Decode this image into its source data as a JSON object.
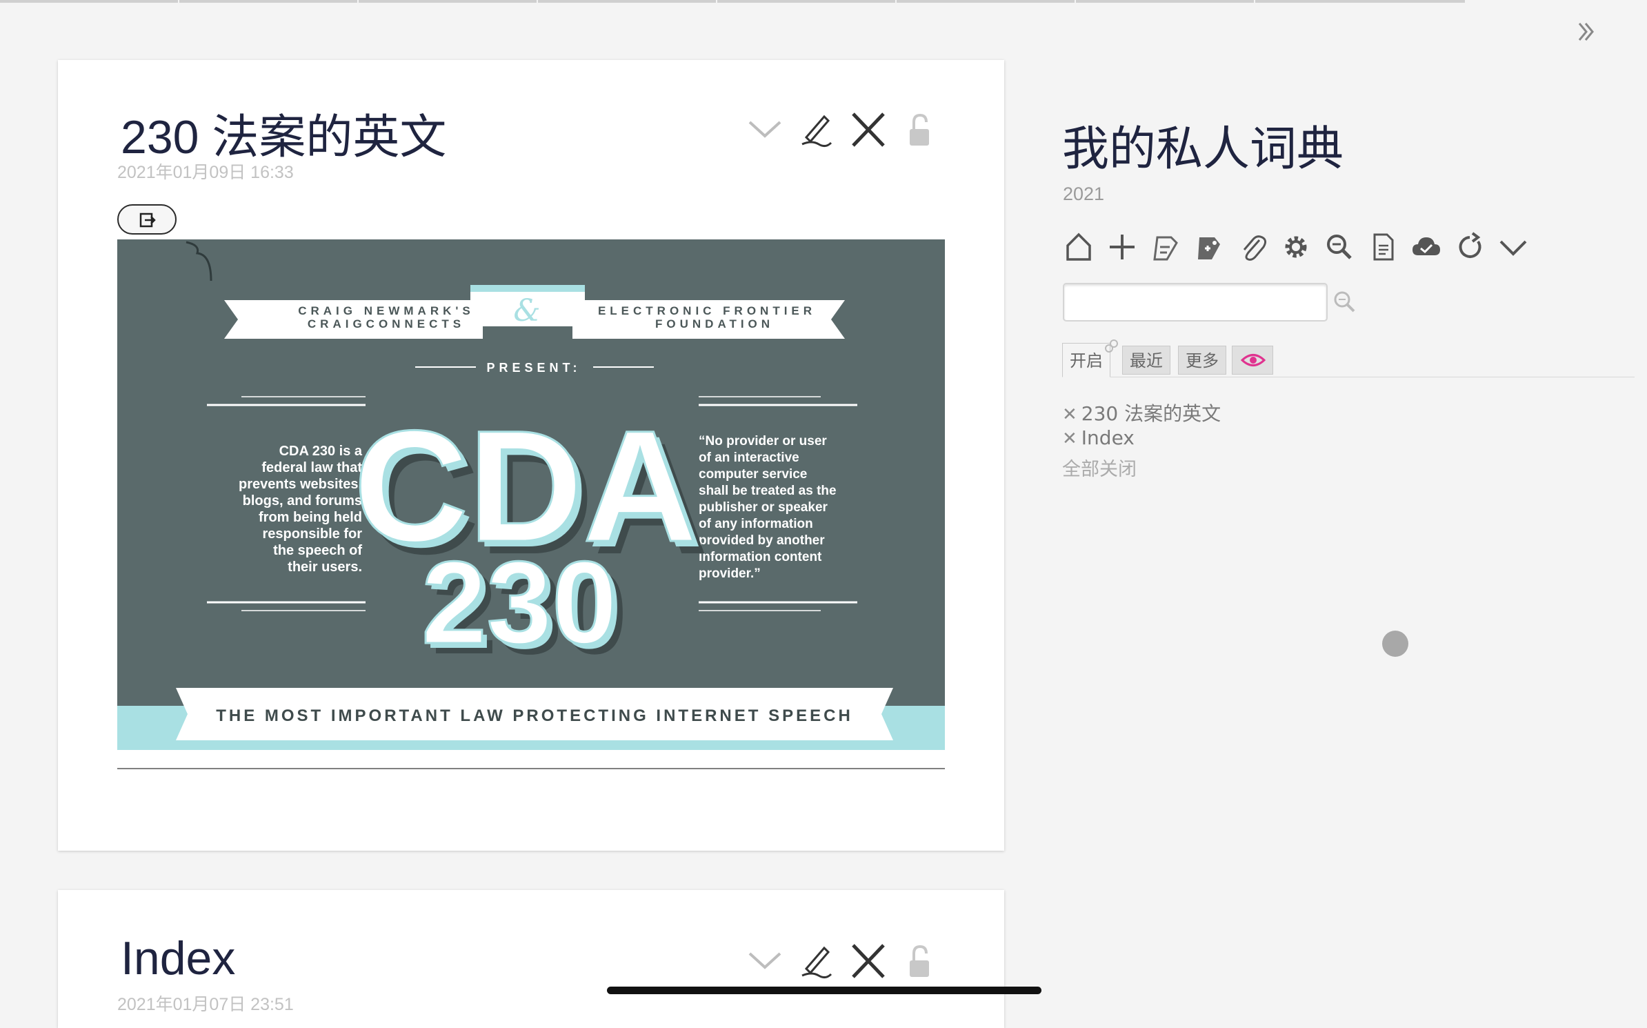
{
  "story": {
    "tiddlers": [
      {
        "title": "230 法案的英文",
        "date": "2021年01月09日 16:33",
        "image": {
          "top_left": "CRAIG NEWMARK'S",
          "top_left_2": "CRAIGCONNECTS",
          "amp": "&",
          "top_right": "ELECTRONIC FRONTIER",
          "top_right_2": "FOUNDATION",
          "present": "PRESENT:",
          "big_1": "CDA",
          "big_2": "230",
          "left_text": [
            "CDA 230 is a",
            "federal law that",
            "prevents websites,",
            "blogs, and forums",
            "from being held",
            "responsible for",
            "the speech of",
            "their users."
          ],
          "right_text": [
            "“No provider or user",
            "of an interactive",
            "computer service",
            "shall be treated as the",
            "publisher or speaker",
            "of any information",
            "provided by another",
            "information content",
            "provider.”"
          ],
          "banner": "THE MOST IMPORTANT LAW PROTECTING INTERNET SPEECH"
        }
      },
      {
        "title": "Index",
        "date": "2021年01月07日 23:51"
      }
    ]
  },
  "sidebar": {
    "title": "我的私人词典",
    "subtitle": "2021",
    "toolbar_icons": [
      "home-icon",
      "new-tiddler-icon",
      "new-journal-icon",
      "new-tag-icon",
      "attachment-icon",
      "gear-icon",
      "advanced-search-icon",
      "new-image-icon",
      "cloud-save-icon",
      "refresh-icon",
      "more-icon"
    ],
    "search": {
      "value": "",
      "placeholder": ""
    },
    "tabs": [
      {
        "label": "开启"
      },
      {
        "label": "最近"
      },
      {
        "label": "更多"
      },
      {
        "label": "eye-icon"
      }
    ],
    "open_items": [
      "230 法案的英文",
      "Index"
    ],
    "close_all": "全部关闭"
  },
  "colors": {
    "title": "#1f2440",
    "poster_bg": "#5a6a6b",
    "poster_accent": "#a9e0e3",
    "eye": "#e0338f"
  }
}
